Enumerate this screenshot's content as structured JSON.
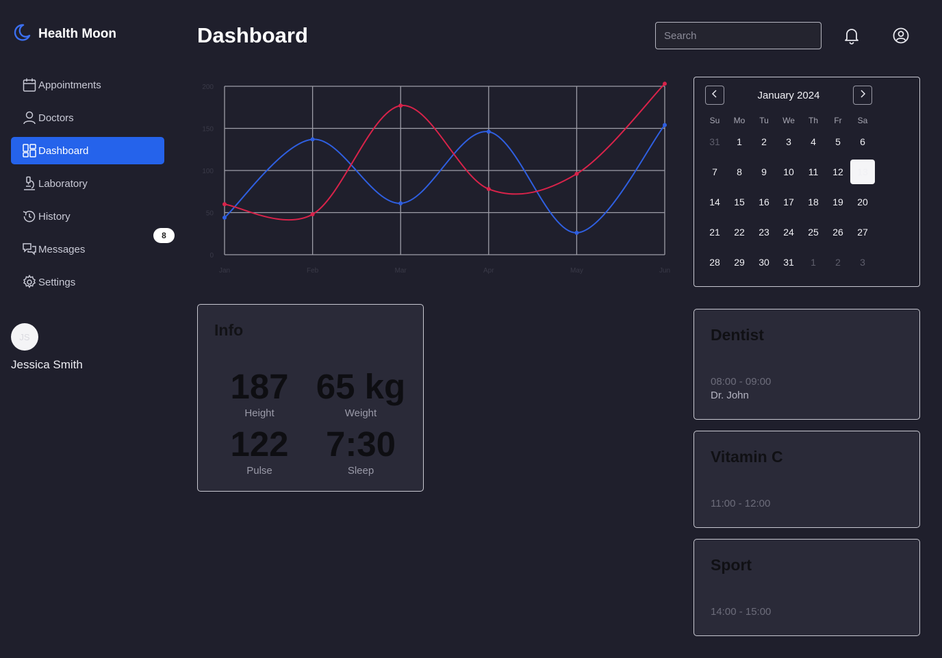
{
  "app": {
    "name": "Health Moon"
  },
  "sidebar": {
    "items": [
      {
        "label": "Appointments",
        "icon": "calendar-icon"
      },
      {
        "label": "Doctors",
        "icon": "user-icon"
      },
      {
        "label": "Dashboard",
        "icon": "dashboard-icon",
        "active": true
      },
      {
        "label": "Laboratory",
        "icon": "microscope-icon"
      },
      {
        "label": "History",
        "icon": "history-icon"
      },
      {
        "label": "Messages",
        "icon": "messages-icon"
      },
      {
        "label": "Settings",
        "icon": "gear-icon"
      }
    ],
    "messages_badge": "8"
  },
  "user": {
    "initials": "JS",
    "name": "Jessica Smith"
  },
  "header": {
    "title": "Dashboard",
    "search_placeholder": "Search"
  },
  "colors": {
    "accent": "#2563eb",
    "series_blue": "#2f5fe0",
    "series_red": "#d8234a",
    "background": "#1f1f2c",
    "card": "#2a2a38"
  },
  "chart_data": {
    "type": "line",
    "categories": [
      "Jan",
      "Feb",
      "Mar",
      "Apr",
      "May",
      "Jun"
    ],
    "ylim": [
      0,
      200
    ],
    "yticks": [
      0,
      50,
      100,
      150,
      200
    ],
    "grid": true,
    "series": [
      {
        "color": "#2f5fe0",
        "values": [
          44,
          137,
          61,
          146,
          26,
          154
        ]
      },
      {
        "color": "#d8234a",
        "values": [
          60,
          48,
          177,
          78,
          96,
          203
        ]
      }
    ]
  },
  "calendar": {
    "month": "January 2024",
    "weekdays": [
      "Su",
      "Mo",
      "Tu",
      "We",
      "Th",
      "Fr",
      "Sa"
    ],
    "days": [
      {
        "d": "31",
        "m": true
      },
      {
        "d": "1"
      },
      {
        "d": "2"
      },
      {
        "d": "3"
      },
      {
        "d": "4"
      },
      {
        "d": "5"
      },
      {
        "d": "6"
      },
      {
        "d": "7"
      },
      {
        "d": "8"
      },
      {
        "d": "9"
      },
      {
        "d": "10"
      },
      {
        "d": "11"
      },
      {
        "d": "12"
      },
      {
        "d": "13",
        "s": true
      },
      {
        "d": "14"
      },
      {
        "d": "15"
      },
      {
        "d": "16"
      },
      {
        "d": "17"
      },
      {
        "d": "18"
      },
      {
        "d": "19"
      },
      {
        "d": "20"
      },
      {
        "d": "21"
      },
      {
        "d": "22"
      },
      {
        "d": "23"
      },
      {
        "d": "24"
      },
      {
        "d": "25"
      },
      {
        "d": "26"
      },
      {
        "d": "27"
      },
      {
        "d": "28"
      },
      {
        "d": "29"
      },
      {
        "d": "30"
      },
      {
        "d": "31"
      },
      {
        "d": "1",
        "m": true
      },
      {
        "d": "2",
        "m": true
      },
      {
        "d": "3",
        "m": true
      }
    ]
  },
  "info": {
    "title": "Info",
    "stats": [
      {
        "value": "187",
        "label": "Height"
      },
      {
        "value": "65 kg",
        "label": "Weight"
      },
      {
        "value": "122",
        "label": "Pulse"
      },
      {
        "value": "7:30",
        "label": "Sleep"
      }
    ]
  },
  "events": [
    {
      "title": "Dentist",
      "time": "08:00 - 09:00",
      "doctor": "Dr. John"
    },
    {
      "title": "Vitamin C",
      "time": "11:00 - 12:00"
    },
    {
      "title": "Sport",
      "time": "14:00 - 15:00"
    }
  ]
}
